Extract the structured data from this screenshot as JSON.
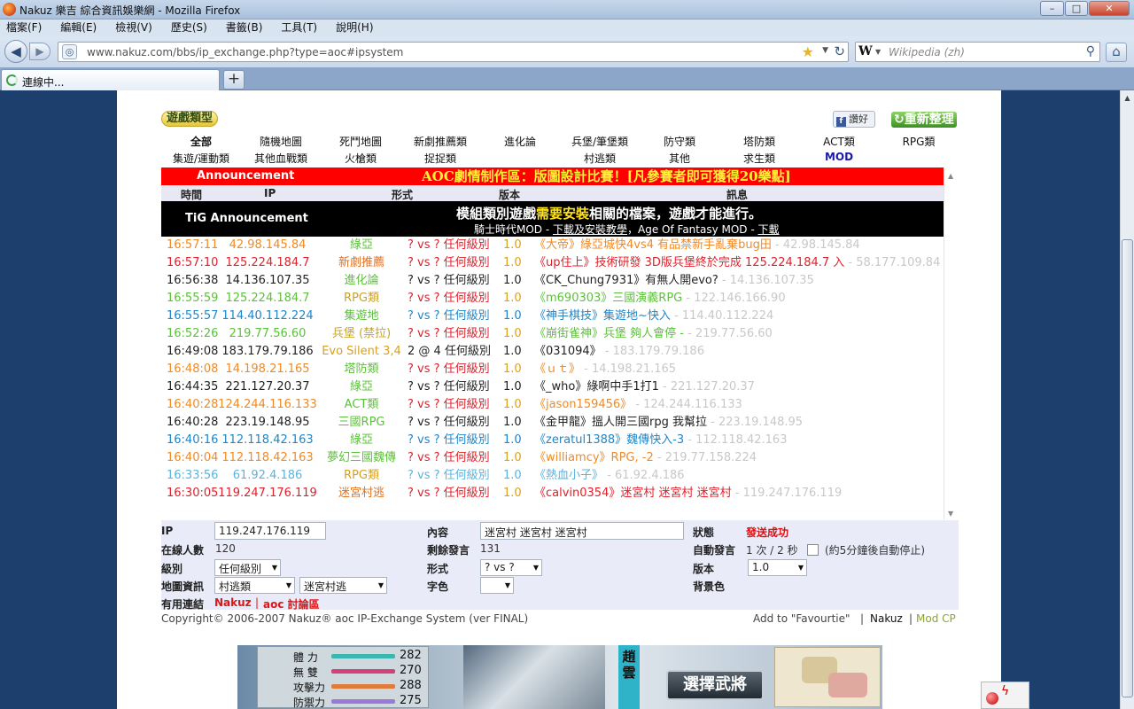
{
  "window": {
    "title": "Nakuz 樂吉 綜合資訊娛樂網 - Mozilla Firefox",
    "min": "–",
    "max": "□",
    "close": "✕"
  },
  "menu": [
    "檔案(F)",
    "編輯(E)",
    "檢視(V)",
    "歷史(S)",
    "書籤(B)",
    "工具(T)",
    "說明(H)"
  ],
  "nav": {
    "url": "www.nakuz.com/bbs/ip_exchange.php?type=aoc#ipsystem",
    "search_placeholder": "Wikipedia (zh)",
    "search_engine": "W"
  },
  "tab": {
    "label": "連線中...",
    "new_tab": "+"
  },
  "header": {
    "category_logo": "遊戲類型",
    "like": "讚好",
    "refresh": "重新整理"
  },
  "categories": [
    [
      "全部",
      "隨機地圖",
      "死鬥地圖",
      "新劇推薦類",
      "進化論",
      "兵堡/筆堡類",
      "防守類",
      "塔防類",
      "ACT類",
      "RPG類"
    ],
    [
      "集遊/運動類",
      "其他血戰類",
      "火槍類",
      "捉捉類",
      "",
      "村逃類",
      "其他",
      "求生類",
      "MOD",
      ""
    ]
  ],
  "announcement": {
    "label": "Announcement",
    "text": "AOC劇情制作區：版圖設計比賽！[凡參賽者即可獲得20樂點]"
  },
  "columns": {
    "time": "時間",
    "ip": "IP",
    "format": "形式",
    "version": "版本",
    "message": "訊息"
  },
  "tig": {
    "label": "TiG Announcement",
    "line1_a": "模組類別遊戲",
    "line1_b": "需要安裝",
    "line1_c": "相關的檔案，遊戲才能進行。",
    "line2_a": "騎士時代MOD - ",
    "line2_b": "下載及安裝教學",
    "line2_c": "，Age Of Fantasy MOD - ",
    "line2_d": "下載"
  },
  "rows": [
    {
      "time": "16:57:11",
      "ip": "42.98.145.84",
      "type": "綠亞",
      "vs": "? vs ? 任何級別",
      "ver": "1.0",
      "msg": "《大帝》綠亞城快4vs4 有品禁新手亂棄bug田",
      "msg_ip": " - 42.98.145.84",
      "color": "#f08a24"
    },
    {
      "time": "16:57:10",
      "ip": "125.224.184.7",
      "type": "新劇推薦",
      "vs": "? vs ? 任何級別",
      "ver": "1.0",
      "msg": "《up住上》技術研發 3D版兵堡終於完成 125.224.184.7 入",
      "msg_ip": " - 58.177.109.84",
      "color": "#e0202a"
    },
    {
      "time": "16:56:38",
      "ip": "14.136.107.35",
      "type": "進化論",
      "vs": "? vs ? 任何級別",
      "ver": "1.0",
      "msg": "《CK_Chung7931》有無人開evo?",
      "msg_ip": " - 14.136.107.35",
      "color": "#222222"
    },
    {
      "time": "16:55:59",
      "ip": "125.224.184.7",
      "type": "RPG類",
      "vs": "? vs ? 任何級別",
      "ver": "1.0",
      "msg": "《m690303》三國演義RPG",
      "msg_ip": " - 122.146.166.90",
      "color": "#5cc13a"
    },
    {
      "time": "16:55:57",
      "ip": "114.40.112.224",
      "type": "集遊地",
      "vs": "? vs ? 任何級別",
      "ver": "1.0",
      "msg": "《神手棋技》集遊地~快入",
      "msg_ip": " - 114.40.112.224",
      "color": "#1f86c8"
    },
    {
      "time": "16:52:26",
      "ip": "219.77.56.60",
      "type": "兵堡 (禁拉)",
      "vs": "? vs ? 任何級別",
      "ver": "1.0",
      "msg": "《崩街雀神》兵堡 夠人會停 -",
      "msg_ip": " - 219.77.56.60",
      "color": "#5cc13a"
    },
    {
      "time": "16:49:08",
      "ip": "183.179.79.186",
      "type": "Evo Silent 3,4",
      "vs": "2 @ 4 任何級別",
      "ver": "1.0",
      "msg": "《031094》",
      "msg_ip": " - 183.179.79.186",
      "color": "#222222"
    },
    {
      "time": "16:48:08",
      "ip": "14.198.21.165",
      "type": "塔防類",
      "vs": "? vs ? 任何級別",
      "ver": "1.0",
      "msg": "《ｕｔ》",
      "msg_ip": " - 14.198.21.165",
      "color": "#f08a24"
    },
    {
      "time": "16:44:35",
      "ip": "221.127.20.37",
      "type": "綠亞",
      "vs": "? vs ? 任何級別",
      "ver": "1.0",
      "msg": "《_who》綠啊中手1打1",
      "msg_ip": " - 221.127.20.37",
      "color": "#222222"
    },
    {
      "time": "16:40:28",
      "ip": "124.244.116.133",
      "type": "ACT類",
      "vs": "? vs ? 任何級別",
      "ver": "1.0",
      "msg": "《jason159456》",
      "msg_ip": " - 124.244.116.133",
      "color": "#f08a24"
    },
    {
      "time": "16:40:28",
      "ip": "223.19.148.95",
      "type": "三國RPG",
      "vs": "? vs ? 任何級別",
      "ver": "1.0",
      "msg": "《金甲龍》搵人開三國rpg 我幫拉",
      "msg_ip": " - 223.19.148.95",
      "color": "#222222"
    },
    {
      "time": "16:40:16",
      "ip": "112.118.42.163",
      "type": "綠亞",
      "vs": "? vs ? 任何級別",
      "ver": "1.0",
      "msg": "《zeratul1388》魏傳快入-3",
      "msg_ip": " - 112.118.42.163",
      "color": "#1f86c8"
    },
    {
      "time": "16:40:04",
      "ip": "112.118.42.163",
      "type": "夢幻三國魏傳",
      "vs": "? vs ? 任何級別",
      "ver": "1.0",
      "msg": "《williamcy》RPG, -2",
      "msg_ip": " - 219.77.158.224",
      "color": "#f08a24"
    },
    {
      "time": "16:33:56",
      "ip": "61.92.4.186",
      "type": "RPG類",
      "vs": "? vs ? 任何級別",
      "ver": "1.0",
      "msg": "《熱血小子》",
      "msg_ip": " - 61.92.4.186",
      "color": "#5ab4de"
    },
    {
      "time": "16:30:05",
      "ip": "119.247.176.119",
      "type": "迷宮村逃",
      "vs": "? vs ? 任何級別",
      "ver": "1.0",
      "msg": "《calvin0354》迷宮村 迷宮村 迷宮村",
      "msg_ip": " - 119.247.176.119",
      "color": "#e0202a"
    }
  ],
  "form": {
    "ip_label": "IP",
    "ip_value": "119.247.176.119",
    "online_label": "在線人數",
    "online_value": "120",
    "level_label": "級別",
    "level_value": "任何級別",
    "map_label": "地圖資訊",
    "map_type": "村逃類",
    "map_name": "迷宮村逃",
    "links_label": "有用連結",
    "link1": "Nakuz",
    "link_sep": "|",
    "link2": "aoc 討論區",
    "content_label": "內容",
    "content_value": "迷宮村 迷宮村 迷宮村",
    "remain_label": "剩餘發言",
    "remain_value": "131",
    "format_label": "形式",
    "format_value": "? vs ?",
    "color_label": "字色",
    "status_label": "狀態",
    "status_value": "發送成功",
    "auto_label": "自動發言",
    "auto_value": "1 次 / 2 秒",
    "auto_note": "(約5分鐘後自動停止)",
    "version_label": "版本",
    "version_value": "1.0",
    "bg_label": "背景色"
  },
  "footer": {
    "copyright": "Copyright© 2006-2007  Nakuz® aoc IP-Exchange System (ver FINAL)",
    "fav": "Add to \"Favourtie\"",
    "sep": "|",
    "nakuz": "Nakuz",
    "modcp": "Mod CP"
  },
  "banner": {
    "stats": [
      {
        "name": "體 力",
        "value": "282",
        "color": "#3cb6b0"
      },
      {
        "name": "無 雙",
        "value": "270",
        "color": "#d2417d"
      },
      {
        "name": "攻擊力",
        "value": "288",
        "color": "#e07b3c"
      },
      {
        "name": "防禦力",
        "value": "275",
        "color": "#9a7ad6"
      }
    ],
    "hero_name": "趙雲",
    "pick_button": "選擇武將"
  }
}
